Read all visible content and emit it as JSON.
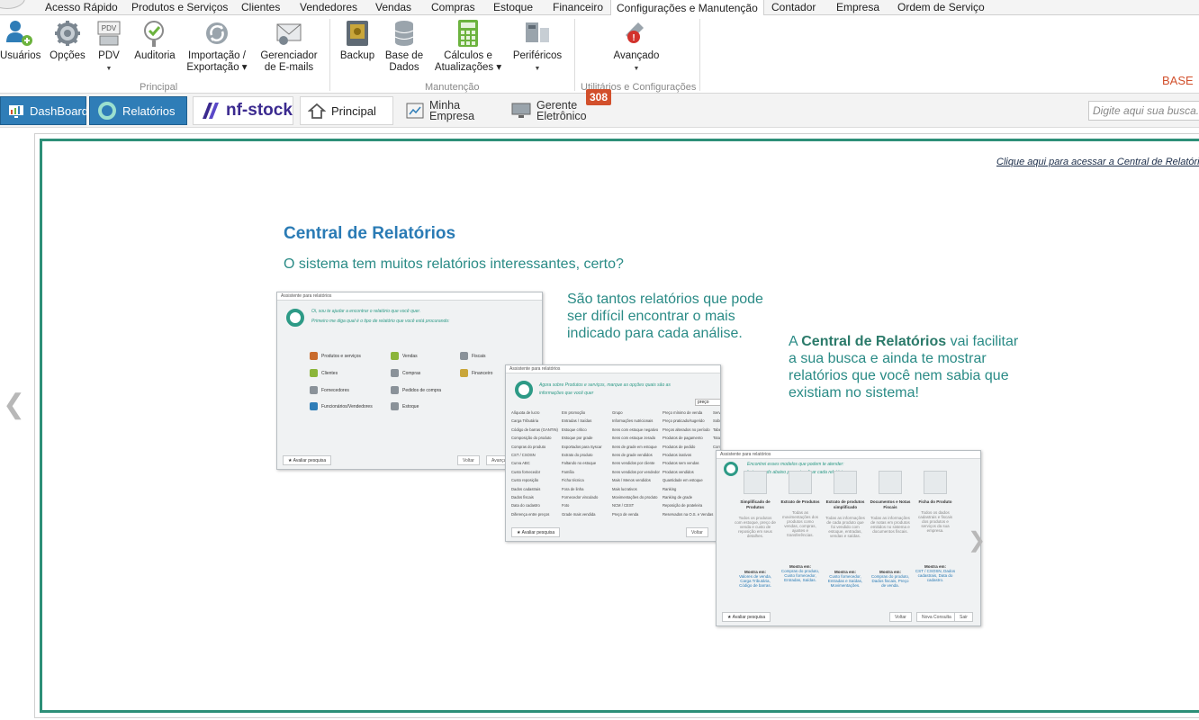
{
  "menu_tabs": [
    "Acesso Rápido",
    "Produtos e Serviços",
    "Clientes",
    "Vendedores",
    "Vendas",
    "Compras",
    "Estoque",
    "Financeiro",
    "Configurações e Manutenção",
    "Contador",
    "Empresa",
    "Ordem de Serviço"
  ],
  "active_tab": "Configurações e Manutenção",
  "ribbon": {
    "principal": {
      "label": "Principal",
      "buttons": [
        "Usuários",
        "Opções",
        "PDV",
        "Auditoria",
        "Importação /",
        "Exportação",
        "Gerenciador",
        "de E-mails"
      ]
    },
    "manutencao": {
      "label": "Manutenção",
      "buttons": [
        "Backup",
        "Base de",
        "Dados",
        "Cálculos e",
        "Atualizações",
        "Periféricos"
      ]
    },
    "utilitarios": {
      "label": "Utilitários e Configurações",
      "buttons": [
        "Avançado"
      ]
    },
    "pdv_icon_text": "PDV",
    "base_label": "BASE"
  },
  "quickbar": {
    "dashboard": "DashBoard",
    "relatorios": "Relatórios",
    "nfstock": "nf-stock",
    "principal": "Principal",
    "minha_empresa": [
      "Minha",
      "Empresa"
    ],
    "gerente": [
      "Gerente",
      "Eletrônico"
    ],
    "badge": "308",
    "search_placeholder": "Digite aqui sua busca..."
  },
  "content": {
    "top_link": "Clique aqui para acessar a Central de Relatórios",
    "title": "Central de Relatórios",
    "subtitle": "O sistema tem muitos relatórios interessantes, certo?",
    "paragraph1": "São tantos relatórios que pode ser difícil encontrar o mais indicado para cada análise.",
    "paragraph2_prefix": "A ",
    "paragraph2_bold": "Central de Relatórios",
    "paragraph2_suffix": " vai facilitar a sua busca e ainda te mostrar relatórios que você nem sabia que existiam no sistema!"
  },
  "shot1": {
    "title": "Assistente para relatórios",
    "q1": "Oi, sou te ajudar a encontrar o relatório que você quer.",
    "q2": "Primeiro me diga qual é o tipo de relatório que você está procurando:",
    "options": [
      "Produtos e serviços",
      "Clientes",
      "Fornecedores",
      "Funcionários/Vendedores",
      "Vendas",
      "Compras",
      "Pedidos de compra",
      "Estoque",
      "Fiscais",
      "Financeiro"
    ],
    "foot": "Avaliar pesquisa",
    "voltar": "Voltar",
    "avancar": "Avançar"
  },
  "shot2": {
    "title": "Assistente para relatórios",
    "q1": "Agora sobre Produtos e serviços, marque as opções quais são as",
    "q2": "informações que você quer",
    "search": "preço",
    "items": [
      "Alíquota de lucro",
      "Carga Tributária",
      "Código de barras (GANTIN)",
      "Composição do produto",
      "Compras do produto",
      "CST / CSOSN",
      "Curva ABC",
      "Custo fornecedor",
      "Custo reposição",
      "Dados cadastrais",
      "Dados fiscais",
      "Data do cadastro",
      "Diferença entre preços",
      "Em promoção",
      "Entradas / Saídas",
      "Estoque crítico",
      "Estoque por grade",
      "Exportados para Syscar",
      "Extrato do produto",
      "Faltando no estoque",
      "Família",
      "Ficha técnica",
      "Fora de linha",
      "Fornecedor vinculado",
      "Foto",
      "Grade mais vendida",
      "Grupo",
      "Informações nutricionais",
      "Itens com estoque negativo",
      "Itens com estoque zerado",
      "Itens de grade em estoque",
      "Itens de grade vendidos",
      "Itens vendidos por cliente",
      "Itens vendidos por vendedor",
      "Mais / Menos vendidos",
      "Mais lucrativos",
      "Movimentações do produto",
      "NCM / CEST",
      "Preço de venda",
      "Preço mínimo de venda",
      "Preço praticado/sugerido",
      "Preços alterados no período",
      "Produtos de pagamento",
      "Produtos de pedido",
      "Produtos inativos",
      "Produtos sem vendas",
      "Produtos vendidos",
      "Quantidade em estoque",
      "Ranking",
      "Ranking de grade",
      "Reposição de prateleira",
      "Reservados na O.S. e Vendas",
      "Serviços",
      "Sobrando no estoque",
      "Tabela de preços",
      "Total por Grupo",
      "Com últimas compras"
    ],
    "foot": "Avaliar pesquisa",
    "voltar": "Voltar"
  },
  "shot3": {
    "title": "Assistente para relatórios",
    "q1": "Encontrei esses modelos que podem te atender:",
    "q2": "Lei as cards abaixo para visualizar cada relatório",
    "cards": [
      {
        "t": "Simplificado de Produtos",
        "d": "Todos os produtos com estoque, preço de venda e custo de reposição em seus detalhes.",
        "m": "Mostra em:",
        "l": "Valores de venda, Carga Tributária, Código de barras."
      },
      {
        "t": "Extrato de Produtos",
        "d": "Todas as movimentações dos produtos como vendas, compras, ajustes e transferências.",
        "m": "Mostra em:",
        "l": "Compras do produto, Custo fornecedor, Entradas, Saídas."
      },
      {
        "t": "Extrato de produtos simplificado",
        "d": "Todas as informações de cada produto que foi vendido com estoque, entradas, vendas e saídas.",
        "m": "Mostra em:",
        "l": "Custo fornecedor, Entradas e Saídas, Movimentações."
      },
      {
        "t": "Documentos e Notas Fiscais",
        "d": "Todas as informações de notas em produtos emitidos no sistema e documentos fiscais.",
        "m": "Mostra em:",
        "l": "Compras do produto, Dados fiscais, Preço de venda."
      },
      {
        "t": "Ficha do Produto",
        "d": "Todos os dados cadastrais e fiscais dos produtos e serviços da sua empresa.",
        "m": "Mostra em:",
        "l": "CST / CSOSN, Dados cadastrais, Data do cadastro."
      }
    ],
    "foot": "Avaliar pesquisa",
    "voltar": "Voltar",
    "nova": "Nova Consulta",
    "sair": "Sair"
  }
}
